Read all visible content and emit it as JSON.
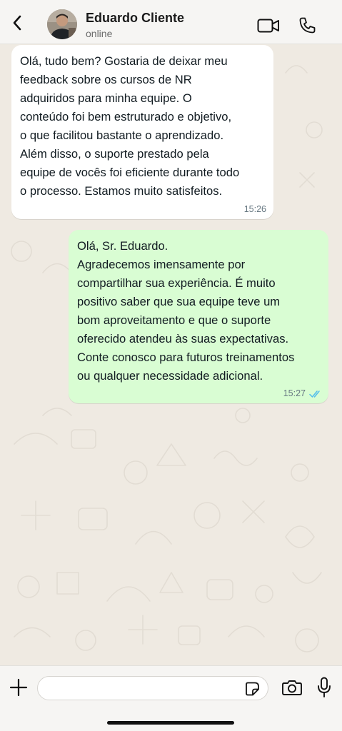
{
  "header": {
    "contact_name": "Eduardo Cliente",
    "status": "online"
  },
  "icons": {
    "back": "chevron-left-icon",
    "video": "video-camera-icon",
    "call": "phone-icon",
    "plus": "plus-icon",
    "sticker": "sticker-icon",
    "camera": "camera-icon",
    "mic": "microphone-icon",
    "read": "double-check-icon"
  },
  "messages": [
    {
      "direction": "incoming",
      "text": "Olá, tudo bem? Gostaria de deixar meu\nfeedback sobre os cursos de NR\nadquiridos para minha equipe. O\nconteúdo foi bem estruturado e objetivo,\no que facilitou bastante o aprendizado.\nAlém disso, o suporte prestado pela\nequipe de vocês foi eficiente durante todo\no processo. Estamos muito satisfeitos.",
      "time": "15:26"
    },
    {
      "direction": "outgoing",
      "text": "Olá, Sr. Eduardo.\nAgradecemos imensamente por\ncompartilhar sua experiência. É muito\npositivo saber que sua equipe teve um\nbom aproveitamento e que o suporte\noferecido atendeu às suas expectativas.\nConte conosco para futuros treinamentos\nou qualquer necessidade adicional.",
      "time": "15:27",
      "status": "read"
    }
  ],
  "composer": {
    "value": "",
    "placeholder": ""
  },
  "colors": {
    "chat_background": "#efeae2",
    "incoming_bubble": "#ffffff",
    "outgoing_bubble": "#d9fdd3",
    "read_ticks": "#53bdeb",
    "bars": "#f6f5f3"
  }
}
